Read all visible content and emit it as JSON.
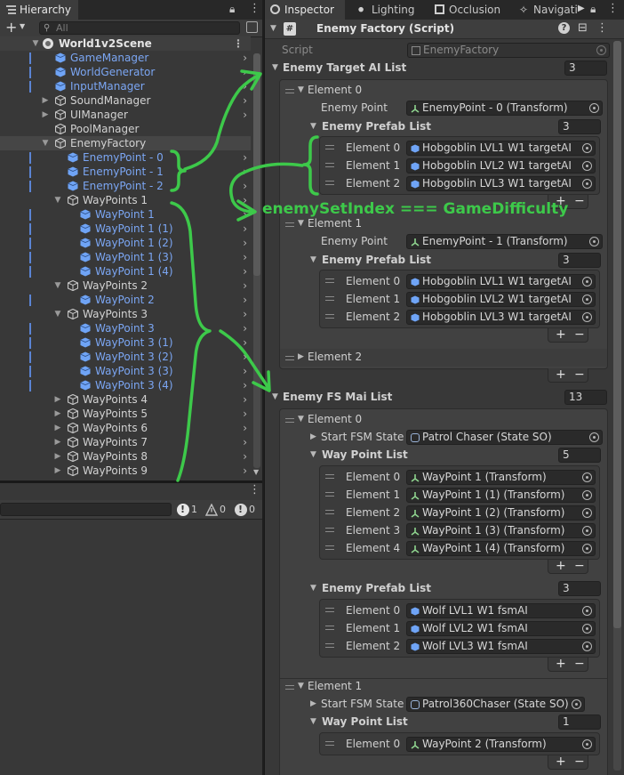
{
  "hierarchy": {
    "tab_title": "Hierarchy",
    "search_placeholder": "All",
    "add_label": "+",
    "scene_name": "World1v2Scene",
    "items": [
      {
        "label": "GameManager",
        "prefab": true
      },
      {
        "label": "WorldGenerator",
        "prefab": true
      },
      {
        "label": "InputManager",
        "prefab": true
      },
      {
        "label": "SoundManager",
        "prefab": false
      },
      {
        "label": "UIManager",
        "prefab": false
      },
      {
        "label": "PoolManager",
        "prefab": false
      },
      {
        "label": "EnemyFactory",
        "prefab": false
      },
      {
        "label": "EnemyPoint - 0",
        "prefab": true
      },
      {
        "label": "EnemyPoint - 1",
        "prefab": true
      },
      {
        "label": "EnemyPoint - 2",
        "prefab": true
      },
      {
        "label": "WayPoints 1",
        "prefab": false
      },
      {
        "label": "WayPoint 1",
        "prefab": true
      },
      {
        "label": "WayPoint 1 (1)",
        "prefab": true
      },
      {
        "label": "WayPoint 1 (2)",
        "prefab": true
      },
      {
        "label": "WayPoint 1 (3)",
        "prefab": true
      },
      {
        "label": "WayPoint 1 (4)",
        "prefab": true
      },
      {
        "label": "WayPoints 2",
        "prefab": false
      },
      {
        "label": "WayPoint 2",
        "prefab": true
      },
      {
        "label": "WayPoints 3",
        "prefab": false
      },
      {
        "label": "WayPoint 3",
        "prefab": true
      },
      {
        "label": "WayPoint 3 (1)",
        "prefab": true
      },
      {
        "label": "WayPoint 3 (2)",
        "prefab": true
      },
      {
        "label": "WayPoint 3 (3)",
        "prefab": true
      },
      {
        "label": "WayPoint 3 (4)",
        "prefab": true
      },
      {
        "label": "WayPoints 4",
        "prefab": false
      },
      {
        "label": "WayPoints 5",
        "prefab": false
      },
      {
        "label": "WayPoints 6",
        "prefab": false
      },
      {
        "label": "WayPoints 7",
        "prefab": false
      },
      {
        "label": "WayPoints 8",
        "prefab": false
      },
      {
        "label": "WayPoints 9",
        "prefab": false
      }
    ]
  },
  "console": {
    "error_count": "1",
    "warning_count": "0",
    "info_count": "0"
  },
  "tabs": {
    "inspector": "Inspector",
    "lighting": "Lighting",
    "occlusion": "Occlusion",
    "navigation": "Navigati"
  },
  "inspector": {
    "component_title": "Enemy Factory (Script)",
    "script_label": "Script",
    "script_value": "EnemyFactory",
    "target_list_label": "Enemy Target AI List",
    "target_list_count": "3",
    "element0_label": "Element 0",
    "element1_label": "Element 1",
    "element2_label": "Element 2",
    "enemy_point_label": "Enemy Point",
    "t_e0_point": "EnemyPoint - 0 (Transform)",
    "t_e1_point": "EnemyPoint - 1 (Transform)",
    "enemy_prefab_list_label": "Enemy Prefab List",
    "t_e0_prefab_count": "3",
    "t_e1_prefab_count": "3",
    "hob1": "Hobgoblin LVL1 W1 targetAI",
    "hob2": "Hobgoblin LVL2 W1 targetAI",
    "hob3": "Hobgoblin LVL3 W1 targetAI",
    "fsm_list_label": "Enemy FS Mai List",
    "fsm_list_count": "13",
    "start_fsm_label": "Start FSM State",
    "f_e0_state": "Patrol Chaser (State SO)",
    "f_e1_state": "Patrol360Chaser (State SO)",
    "way_point_list_label": "Way Point List",
    "f_e0_wp_count": "5",
    "f_e1_wp_count": "1",
    "wp0": "WayPoint 1 (Transform)",
    "wp1": "WayPoint 1 (1) (Transform)",
    "wp2": "WayPoint 1 (2) (Transform)",
    "wp3": "WayPoint 1 (3) (Transform)",
    "wp4": "WayPoint 1 (4) (Transform)",
    "f_e0_prefab_count": "3",
    "wolf1": "Wolf LVL1 W1 fsmAI",
    "wolf2": "Wolf LVL2 W1 fsmAI",
    "wolf3": "Wolf LVL3 W1 fsmAI",
    "f_e1_wp0": "WayPoint 2 (Transform)",
    "element3_label": "Element 3",
    "element4_label": "Element 4",
    "plus": "+",
    "minus": "−"
  },
  "annotation": {
    "text": "enemySetIndex === GameDifficulty",
    "color": "#3dc94a"
  },
  "colors": {
    "prefab_text": "#7ba6f3",
    "panel_bg": "#383838",
    "field_bg": "#2a2a2a",
    "annotation_green": "#3dc94a"
  }
}
